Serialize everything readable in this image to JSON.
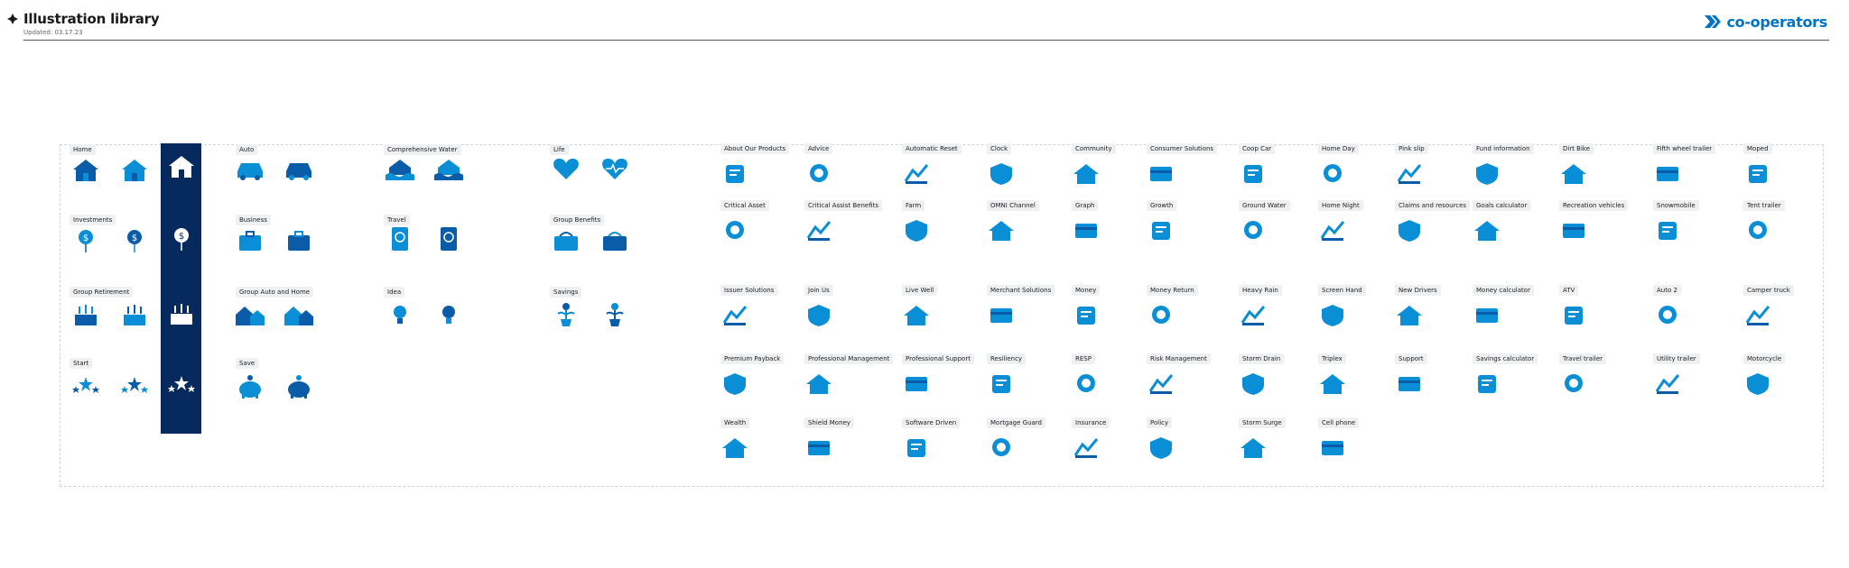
{
  "header": {
    "title": "Illustration library",
    "updated": "Updated: 03.17.23",
    "brand": "co-operators",
    "brand_color": "#0073c4"
  },
  "colors": {
    "icon": "#0a8fd6",
    "icon_dark": "#0a5ca8",
    "band": "#062a5e"
  },
  "left_groups": {
    "home": "Home",
    "investments": "Investments",
    "group_retirement": "Group Retirement",
    "start": "Start",
    "auto": "Auto",
    "business": "Business",
    "group_auto_home": "Group Auto and Home",
    "save": "Save",
    "comprehensive_water": "Comprehensive Water",
    "travel": "Travel",
    "idea": "Idea",
    "life": "Life",
    "group_benefits": "Group Benefits",
    "savings": "Savings"
  },
  "grid": {
    "row1": [
      "About Our Products",
      "Advice",
      "Automatic Reset",
      "Clock",
      "Community",
      "Consumer Solutions",
      "Coop Car",
      "Home Day",
      "Pink slip",
      "Fund information",
      "Dirt Bike",
      "Fifth wheel trailer",
      "Moped"
    ],
    "row2": [
      "Critical Asset",
      "Critical Assist Benefits",
      "Farm",
      "OMNI Channel",
      "Graph",
      "Growth",
      "Ground Water",
      "Home Night",
      "Claims and resources",
      "Goals calculator",
      "Recreation vehicles",
      "Snowmobile",
      "Tent trailer"
    ],
    "row3": [
      "Issuer Solutions",
      "Join Us",
      "Live Well",
      "Merchant Solutions",
      "Money",
      "Money Return",
      "Heavy Rain",
      "Screen Hand",
      "New Drivers",
      "Money calculator",
      "ATV",
      "Auto 2",
      "Camper truck"
    ],
    "row4": [
      "Premium Payback",
      "Professional Management",
      "Professional Support",
      "Resiliency",
      "RESP",
      "Risk Management",
      "Storm Drain",
      "Triplex",
      "Support",
      "Savings calculator",
      "Travel trailer",
      "Utility trailer",
      "Motorcycle"
    ],
    "row5": [
      "Wealth",
      "Shield Money",
      "Software Driven",
      "Mortgage Guard",
      "Insurance",
      "Policy",
      "Storm Surge",
      "Cell phone"
    ]
  },
  "icon_names": {
    "home": "house-icon",
    "investments": "money-balloon-icon",
    "group_retirement": "cake-icon",
    "start": "stars-icon",
    "auto": "car-icon",
    "business": "briefcase-icon",
    "group_auto_home": "houses-icon",
    "save": "piggy-bank-icon",
    "comprehensive_water": "flood-house-icon",
    "travel": "passport-icon",
    "idea": "lightbulb-icon",
    "life": "heart-icon",
    "group_benefits": "bag-icon",
    "savings": "plant-money-icon"
  }
}
